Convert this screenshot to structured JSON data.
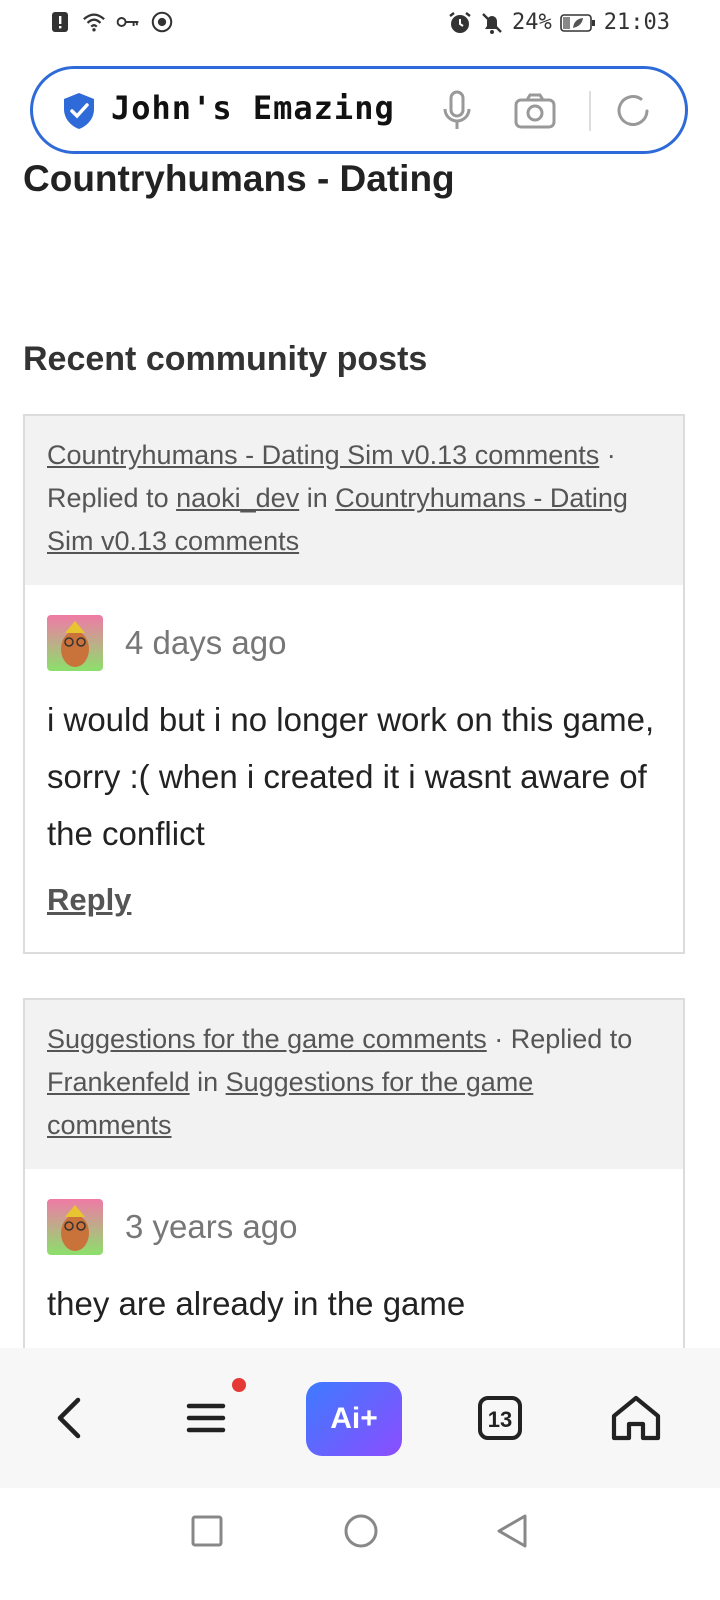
{
  "status_bar": {
    "battery": "24%",
    "time": "21:03"
  },
  "url_bar": {
    "text": "John's Emazing"
  },
  "page": {
    "title": "Countryhumans - Dating",
    "section_title": "Recent community posts"
  },
  "posts": [
    {
      "topic_link": "Countryhumans - Dating Sim v0.13 comments",
      "separator": " · ",
      "replied_to_prefix": "Replied to ",
      "replied_user": "naoki_dev",
      "in_word": " in ",
      "in_link": "Countryhumans - Dating Sim v0.13 comments",
      "time_ago": "4 days ago",
      "comment": "i would but i no longer work on this game, sorry :( when i created it i wasnt aware of the conflict",
      "reply_label": "Reply"
    },
    {
      "topic_link": "Suggestions for the game comments",
      "separator": " · ",
      "replied_to_prefix": "Replied to ",
      "replied_user": "Frankenfeld",
      "in_word": " in ",
      "in_link": "Suggestions for the game comments",
      "time_ago": "3 years ago",
      "comment": "they are already in the game"
    }
  ],
  "toolbar": {
    "ai_label": "Ai+",
    "tabs_count": "13"
  }
}
